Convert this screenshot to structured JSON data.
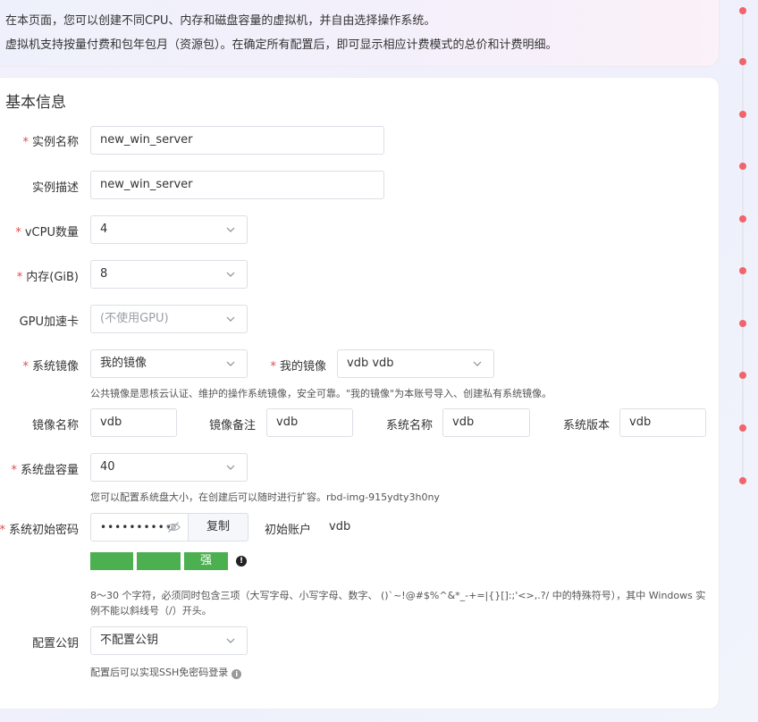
{
  "intro": {
    "line1": "在本页面，您可以创建不同CPU、内存和磁盘容量的虚拟机，并自由选择操作系统。",
    "line2": "虚拟机支持按量付费和包年包月（资源包）。在确定所有配置后，即可显示相应计费模式的总价和计费明细。"
  },
  "section": {
    "title": "基本信息"
  },
  "required_mark": "*",
  "form": {
    "instance_name": {
      "label": "实例名称",
      "value": "new_win_server"
    },
    "instance_desc": {
      "label": "实例描述",
      "value": "new_win_server"
    },
    "vcpu": {
      "label": "vCPU数量",
      "value": "4"
    },
    "memory": {
      "label": "内存(GiB)",
      "value": "8"
    },
    "gpu": {
      "label": "GPU加速卡",
      "value": "(不使用GPU)"
    },
    "image_type": {
      "label": "系统镜像",
      "value": "我的镜像"
    },
    "my_image": {
      "label": "我的镜像",
      "value": "vdb vdb"
    },
    "image_hint": "公共镜像是思核云认证、维护的操作系统镜像，安全可靠。\"我的镜像\"为本账号导入、创建私有系统镜像。",
    "image_name": {
      "label": "镜像名称",
      "value": "vdb"
    },
    "image_note": {
      "label": "镜像备注",
      "value": "vdb"
    },
    "os_name": {
      "label": "系统名称",
      "value": "vdb"
    },
    "os_version": {
      "label": "系统版本",
      "value": "vdb"
    },
    "disk": {
      "label": "系统盘容量",
      "value": "40"
    },
    "disk_hint": "您可以配置系统盘大小，在创建后可以随时进行扩容。rbd-img-915ydty3h0ny",
    "password": {
      "label": "系统初始密码",
      "masked": "••••••••••",
      "copy_label": "复制"
    },
    "init_account": {
      "label": "初始账户",
      "value": "vdb"
    },
    "strength": {
      "label": "强",
      "level": 3,
      "max": 3
    },
    "password_hint": "8～30 个字符，必须同时包含三项（大写字母、小写字母、数字、 ()`~!@#$%^&*_-+=|{}[]:;'<>,.?/ 中的特殊符号），其中 Windows 实例不能以斜线号（/）开头。",
    "ssh_key": {
      "label": "配置公钥",
      "value": "不配置公钥"
    },
    "ssh_hint": "配置后可以实现SSH免密码登录"
  },
  "colors": {
    "accent_required": "#e5484d",
    "strength_bar": "#4caf50",
    "timeline_dot": "#f0646b"
  }
}
